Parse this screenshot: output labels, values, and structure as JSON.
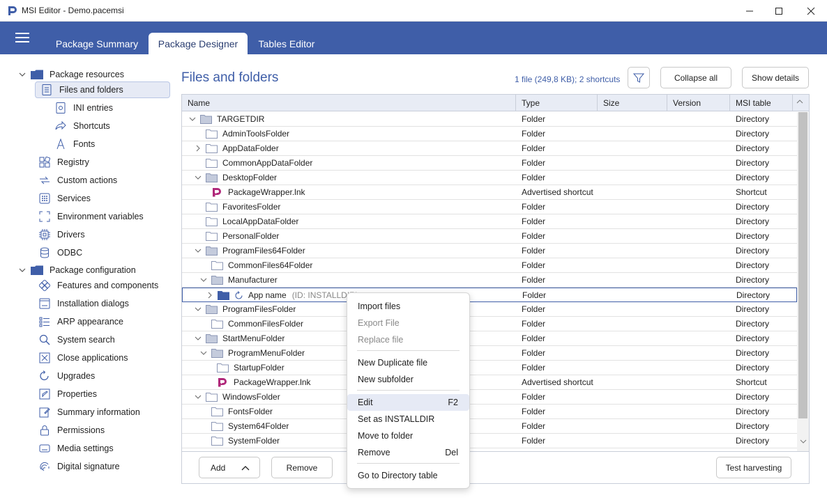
{
  "window": {
    "title": "MSI Editor - Demo.pacemsi"
  },
  "tabs": [
    {
      "label": "Package Summary"
    },
    {
      "label": "Package Designer"
    },
    {
      "label": "Tables Editor"
    }
  ],
  "sidebar": {
    "groups": [
      {
        "label": "Package resources"
      },
      {
        "label": "Package configuration"
      }
    ],
    "items": [
      {
        "label": "Files and folders"
      },
      {
        "label": "INI entries"
      },
      {
        "label": "Shortcuts"
      },
      {
        "label": "Fonts"
      },
      {
        "label": "Registry"
      },
      {
        "label": "Custom actions"
      },
      {
        "label": "Services"
      },
      {
        "label": "Environment variables"
      },
      {
        "label": "Drivers"
      },
      {
        "label": "ODBC"
      },
      {
        "label": "Features and components"
      },
      {
        "label": "Installation dialogs"
      },
      {
        "label": "ARP appearance"
      },
      {
        "label": "System search"
      },
      {
        "label": "Close applications"
      },
      {
        "label": "Upgrades"
      },
      {
        "label": "Properties"
      },
      {
        "label": "Summary information"
      },
      {
        "label": "Permissions"
      },
      {
        "label": "Media settings"
      },
      {
        "label": "Digital signature"
      }
    ]
  },
  "main": {
    "title": "Files and folders",
    "summary": "1 file (249,8 KB); 2 shortcuts",
    "collapse_all": "Collapse all",
    "show_details": "Show details"
  },
  "grid": {
    "columns": [
      "Name",
      "Type",
      "Size",
      "Version",
      "MSI table"
    ],
    "rows": [
      {
        "name": "TARGETDIR",
        "type": "Folder",
        "size": "",
        "version": "",
        "table": "Directory"
      },
      {
        "name": "AdminToolsFolder",
        "type": "Folder",
        "size": "",
        "version": "",
        "table": "Directory"
      },
      {
        "name": "AppDataFolder",
        "type": "Folder",
        "size": "",
        "version": "",
        "table": "Directory"
      },
      {
        "name": "CommonAppDataFolder",
        "type": "Folder",
        "size": "",
        "version": "",
        "table": "Directory"
      },
      {
        "name": "DesktopFolder",
        "type": "Folder",
        "size": "",
        "version": "",
        "table": "Directory"
      },
      {
        "name": "PackageWrapper.lnk",
        "type": "Advertised shortcut",
        "size": "",
        "version": "",
        "table": "Shortcut"
      },
      {
        "name": "FavoritesFolder",
        "type": "Folder",
        "size": "",
        "version": "",
        "table": "Directory"
      },
      {
        "name": "LocalAppDataFolder",
        "type": "Folder",
        "size": "",
        "version": "",
        "table": "Directory"
      },
      {
        "name": "PersonalFolder",
        "type": "Folder",
        "size": "",
        "version": "",
        "table": "Directory"
      },
      {
        "name": "ProgramFiles64Folder",
        "type": "Folder",
        "size": "",
        "version": "",
        "table": "Directory"
      },
      {
        "name": "CommonFiles64Folder",
        "type": "Folder",
        "size": "",
        "version": "",
        "table": "Directory"
      },
      {
        "name": "Manufacturer",
        "type": "Folder",
        "size": "",
        "version": "",
        "table": "Directory"
      },
      {
        "name": "App name",
        "id": "(ID: INSTALLDIR)",
        "type": "Folder",
        "size": "",
        "version": "",
        "table": "Directory"
      },
      {
        "name": "ProgramFilesFolder",
        "type": "Folder",
        "size": "",
        "version": "",
        "table": "Directory"
      },
      {
        "name": "CommonFilesFolder",
        "type": "Folder",
        "size": "",
        "version": "",
        "table": "Directory"
      },
      {
        "name": "StartMenuFolder",
        "type": "Folder",
        "size": "",
        "version": "",
        "table": "Directory"
      },
      {
        "name": "ProgramMenuFolder",
        "type": "Folder",
        "size": "",
        "version": "",
        "table": "Directory"
      },
      {
        "name": "StartupFolder",
        "type": "Folder",
        "size": "",
        "version": "",
        "table": "Directory"
      },
      {
        "name": "PackageWrapper.lnk",
        "type": "Advertised shortcut",
        "size": "",
        "version": "",
        "table": "Shortcut"
      },
      {
        "name": "WindowsFolder",
        "type": "Folder",
        "size": "",
        "version": "",
        "table": "Directory"
      },
      {
        "name": "FontsFolder",
        "type": "Folder",
        "size": "",
        "version": "",
        "table": "Directory"
      },
      {
        "name": "System64Folder",
        "type": "Folder",
        "size": "",
        "version": "",
        "table": "Directory"
      },
      {
        "name": "SystemFolder",
        "type": "Folder",
        "size": "",
        "version": "",
        "table": "Directory"
      }
    ]
  },
  "bottom": {
    "add": "Add",
    "remove": "Remove",
    "test_harvesting": "Test harvesting"
  },
  "context_menu": {
    "items": [
      {
        "label": "Import files",
        "shortcut": ""
      },
      {
        "label": "Export File",
        "shortcut": ""
      },
      {
        "label": "Replace file",
        "shortcut": ""
      },
      {
        "label": "New Duplicate file",
        "shortcut": ""
      },
      {
        "label": "New subfolder",
        "shortcut": ""
      },
      {
        "label": "Edit",
        "shortcut": "F2"
      },
      {
        "label": "Set as INSTALLDIR",
        "shortcut": ""
      },
      {
        "label": "Move to folder",
        "shortcut": ""
      },
      {
        "label": "Remove",
        "shortcut": "Del"
      },
      {
        "label": "Go to Directory table",
        "shortcut": ""
      }
    ]
  },
  "colors": {
    "accent": "#3f5ea8",
    "folder": "#9aa7c8",
    "shortcut_icon": "#b0287a"
  }
}
